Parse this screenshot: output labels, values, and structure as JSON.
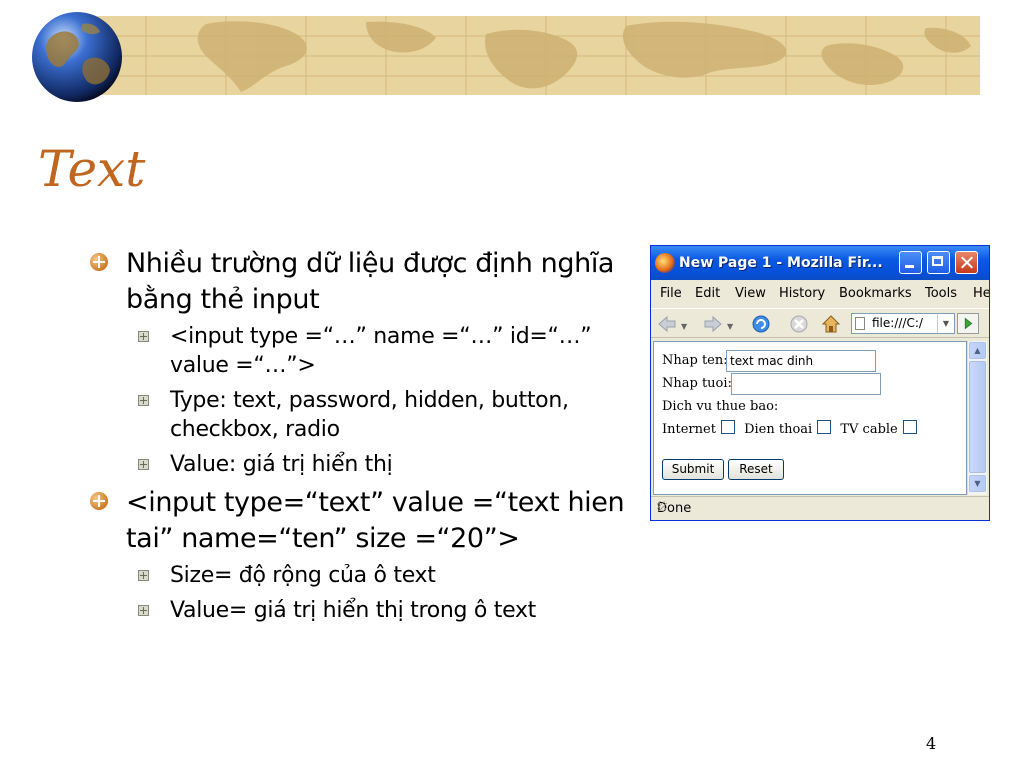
{
  "slide": {
    "title": "Text",
    "page_number": "4",
    "bullets": [
      {
        "text": "Nhiều trường dữ liệu được định nghĩa bằng thẻ input",
        "sub": [
          "<input type =“…” name =“…” id=“…” value =“…”>",
          "Type: text, password, hidden, button, checkbox, radio",
          "Value: giá trị hiển thị"
        ]
      },
      {
        "text": "<input type=“text” value =“text hien tai” name=“ten” size =“20”>",
        "sub": [
          "Size= độ rộng của ô text",
          "Value= giá trị hiển thị trong ô text"
        ]
      }
    ]
  },
  "browser": {
    "window_title": "New Page 1 - Mozilla Fir...",
    "menu": [
      "File",
      "Edit",
      "View",
      "History",
      "Bookmarks",
      "Tools",
      "He"
    ],
    "url": "file:///C:/",
    "form": {
      "name_label": "Nhap ten:",
      "name_value": "text mac dinh",
      "age_label": "Nhap tuoi:",
      "age_value": "",
      "services_label": "Dich vu thue bao:",
      "checkboxes": [
        "Internet",
        "Dien thoai",
        "TV cable"
      ],
      "submit_label": "Submit",
      "reset_label": "Reset"
    },
    "status": "Done"
  },
  "colors": {
    "title": "#c0661e",
    "map_band": "#e8d49e",
    "xp_titlebar": "#0a58e4"
  }
}
